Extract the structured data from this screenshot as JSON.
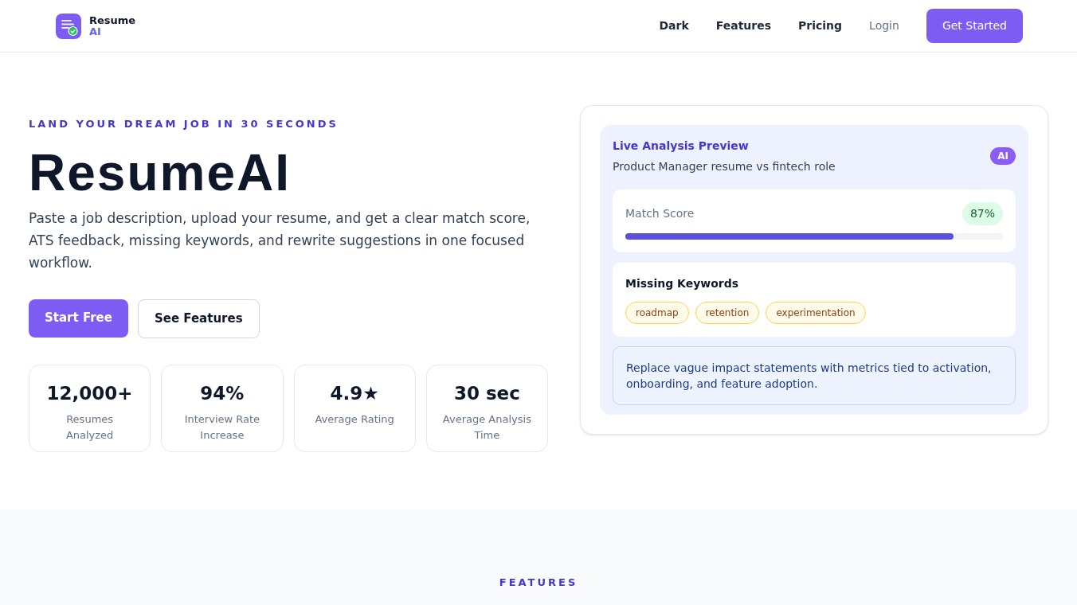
{
  "header": {
    "logo": {
      "line1": "Resume",
      "line2": "AI"
    },
    "nav": [
      {
        "label": "Dark",
        "kind": "link"
      },
      {
        "label": "Features",
        "kind": "link"
      },
      {
        "label": "Pricing",
        "kind": "link"
      },
      {
        "label": "Login",
        "kind": "muted"
      },
      {
        "label": "Get Started",
        "kind": "primary"
      }
    ]
  },
  "hero": {
    "eyebrow": "LAND YOUR DREAM JOB IN 30 SECONDS",
    "title": "ResumeAI",
    "lead": "Paste a job description, upload your resume, and get a clear match score, ATS feedback, missing keywords, and rewrite suggestions in one focused workflow.",
    "buttons": [
      {
        "label": "Start Free",
        "kind": "primary"
      },
      {
        "label": "See Features",
        "kind": "outline"
      }
    ],
    "stats": [
      {
        "value": "12,000+",
        "label": "Resumes Analyzed"
      },
      {
        "value": "94%",
        "label": "Interview Rate Increase"
      },
      {
        "value": "4.9★",
        "label": "Average Rating"
      },
      {
        "value": "30 sec",
        "label": "Average Analysis Time"
      }
    ]
  },
  "preview": {
    "title": "Live Analysis Preview",
    "subtitle": "Product Manager resume vs fintech role",
    "badge": "AI",
    "match": {
      "label": "Match Score",
      "reading": "87%",
      "level": 0.87
    },
    "missing": {
      "title": "Missing Keywords",
      "keywords": [
        "roadmap",
        "retention",
        "experimentation"
      ]
    },
    "suggestion": "Replace vague impact statements with metrics tied to activation, onboarding, and feature adoption."
  },
  "features": {
    "eyebrow": "FEATURES"
  }
}
